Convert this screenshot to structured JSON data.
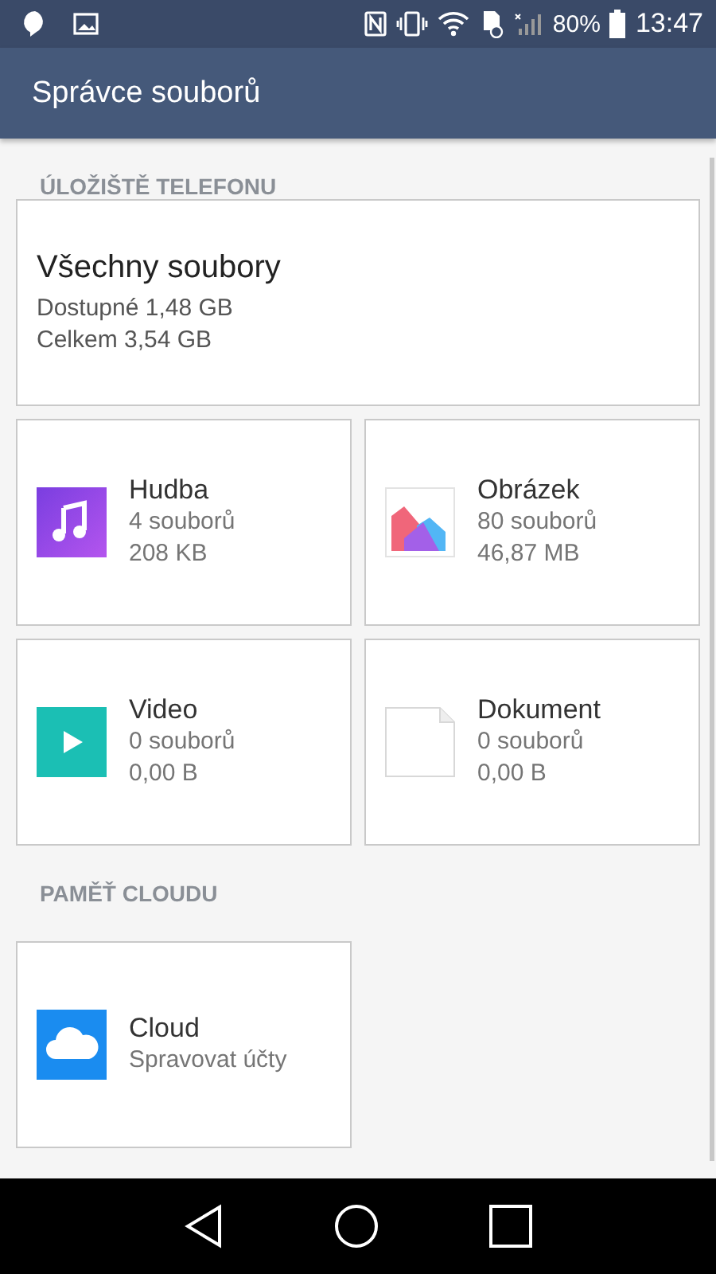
{
  "status_bar": {
    "battery": "80%",
    "time": "13:47"
  },
  "app_bar": {
    "title": "Správce souborů"
  },
  "sections": [
    {
      "title": "ÚLOŽIŠTĚ TELEFONU",
      "cards": [
        {
          "kind": "all",
          "title": "Všechny soubory",
          "lines": [
            "Dostupné 1,48 GB",
            "Celkem 3,54 GB"
          ]
        },
        {
          "kind": "music",
          "title": "Hudba",
          "lines": [
            "4 souborů",
            "208 KB"
          ]
        },
        {
          "kind": "image",
          "title": "Obrázek",
          "lines": [
            "80 souborů",
            "46,87 MB"
          ]
        },
        {
          "kind": "video",
          "title": "Video",
          "lines": [
            "0 souborů",
            "0,00 B"
          ]
        },
        {
          "kind": "document",
          "title": "Dokument",
          "lines": [
            "0 souborů",
            "0,00 B"
          ]
        }
      ]
    },
    {
      "title": "PAMĚŤ CLOUDU",
      "cards": [
        {
          "kind": "cloud",
          "title": "Cloud",
          "lines": [
            "Spravovat účty"
          ]
        }
      ]
    }
  ]
}
